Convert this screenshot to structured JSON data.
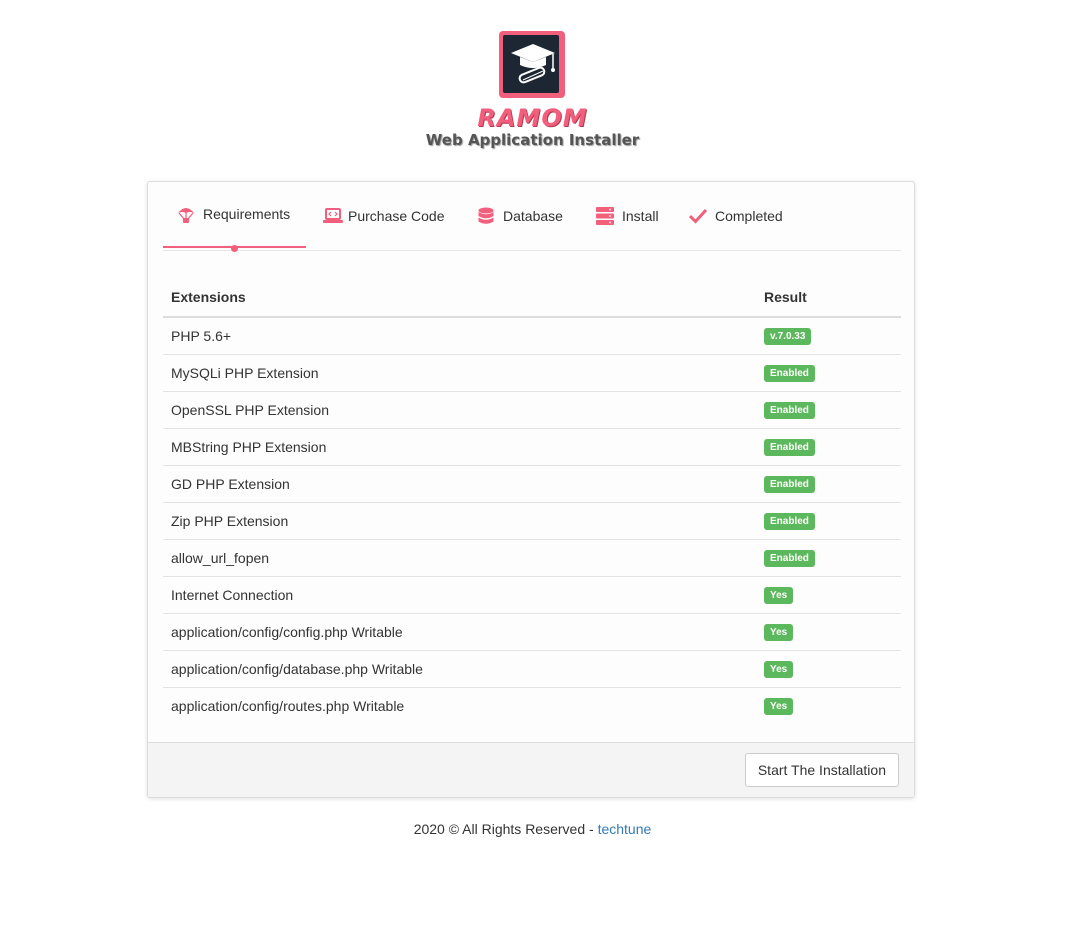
{
  "header": {
    "brand": "RAMOM",
    "subtitle": "Web Application Installer",
    "accent_color": "#f25f7c"
  },
  "tabs": [
    {
      "label": "Requirements",
      "icon": "parachute-icon",
      "active": true
    },
    {
      "label": "Purchase Code",
      "icon": "laptop-code-icon",
      "active": false
    },
    {
      "label": "Database",
      "icon": "database-icon",
      "active": false
    },
    {
      "label": "Install",
      "icon": "server-icon",
      "active": false
    },
    {
      "label": "Completed",
      "icon": "check-icon",
      "active": false
    }
  ],
  "table": {
    "headers": [
      "Extensions",
      "Result"
    ],
    "rows": [
      {
        "name": "PHP 5.6+",
        "result": "v.7.0.33"
      },
      {
        "name": "MySQLi PHP Extension",
        "result": "Enabled"
      },
      {
        "name": "OpenSSL PHP Extension",
        "result": "Enabled"
      },
      {
        "name": "MBString PHP Extension",
        "result": "Enabled"
      },
      {
        "name": "GD PHP Extension",
        "result": "Enabled"
      },
      {
        "name": "Zip PHP Extension",
        "result": "Enabled"
      },
      {
        "name": "allow_url_fopen",
        "result": "Enabled"
      },
      {
        "name": "Internet Connection",
        "result": "Yes"
      },
      {
        "name": "application/config/config.php Writable",
        "result": "Yes"
      },
      {
        "name": "application/config/database.php Writable",
        "result": "Yes"
      },
      {
        "name": "application/config/routes.php Writable",
        "result": "Yes"
      }
    ],
    "badge_color": "#5cb85c"
  },
  "actions": {
    "start_label": "Start The Installation"
  },
  "footer": {
    "text": "2020 © All Rights Reserved - ",
    "link_text": "techtune",
    "link_color": "#337ab7"
  }
}
